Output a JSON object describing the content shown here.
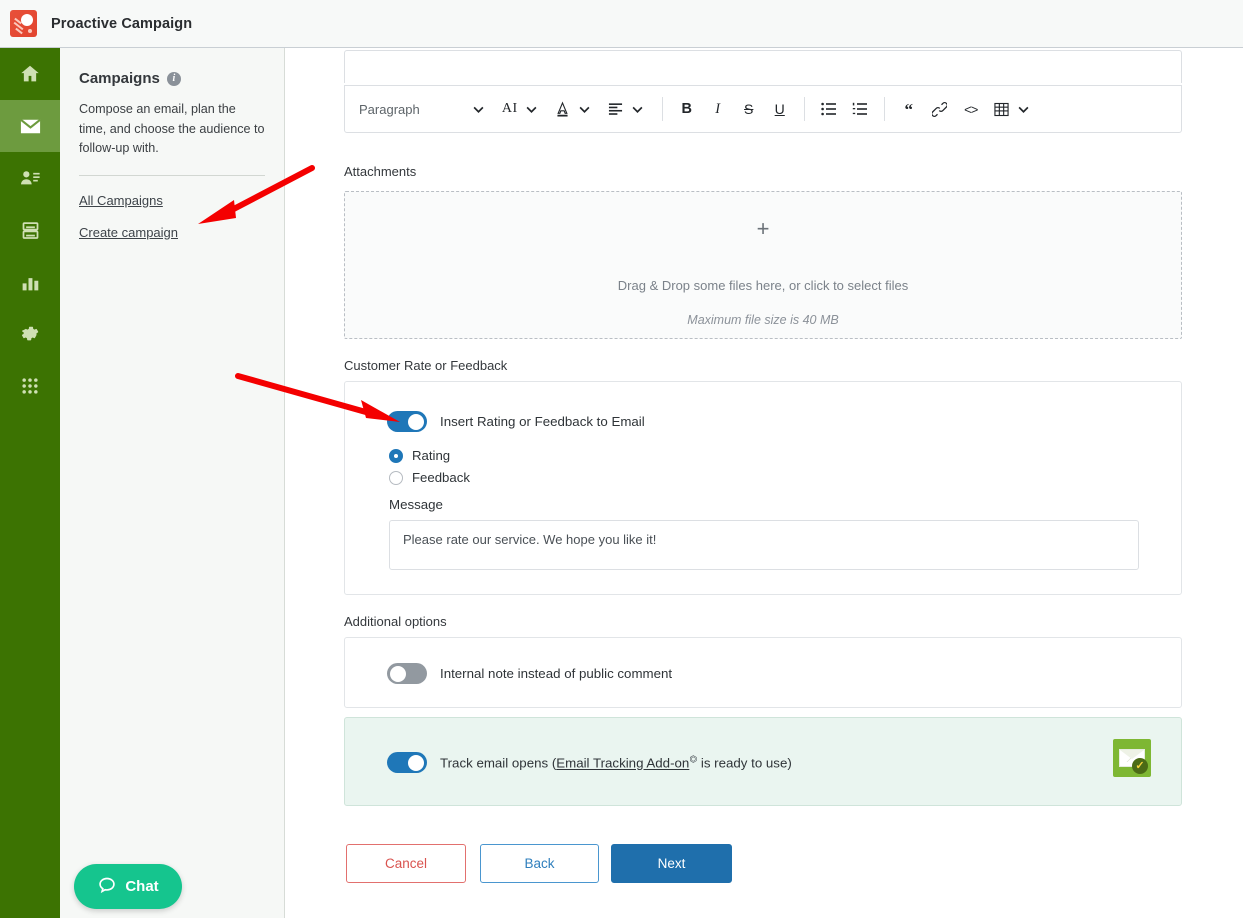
{
  "app": {
    "title": "Proactive Campaign",
    "logo_icon": "comet-logo-icon"
  },
  "rail": {
    "items": [
      {
        "name": "home",
        "icon": "home-icon",
        "active": false
      },
      {
        "name": "mail",
        "icon": "envelope-icon",
        "active": true
      },
      {
        "name": "contacts",
        "icon": "user-list-icon",
        "active": false
      },
      {
        "name": "knowledge-base",
        "icon": "database-icon",
        "active": false
      },
      {
        "name": "reports",
        "icon": "bar-chart-icon",
        "active": false
      },
      {
        "name": "settings",
        "icon": "gear-icon",
        "active": false
      },
      {
        "name": "apps",
        "icon": "grid-dots-icon",
        "active": false
      }
    ]
  },
  "panel": {
    "title": "Campaigns",
    "info_icon": "info-icon",
    "description": "Compose an email, plan the time, and choose the audience to follow-up with.",
    "links": [
      {
        "label": "All Campaigns"
      },
      {
        "label": "Create campaign"
      }
    ]
  },
  "chat": {
    "label": "Chat",
    "icon": "chat-bubble-icon",
    "color": "#15c58e"
  },
  "toolbar": {
    "block_format": "Paragraph",
    "ai_label": "AI",
    "buttons": [
      {
        "name": "block-format-chevron",
        "icon": "chevron-down-icon"
      },
      {
        "name": "ai-tools",
        "icon": "ai-text-icon"
      },
      {
        "name": "ai-chevron",
        "icon": "chevron-down-icon"
      },
      {
        "name": "text-color",
        "icon": "text-color-icon"
      },
      {
        "name": "text-color-chevron",
        "icon": "chevron-down-icon"
      },
      {
        "name": "align",
        "icon": "align-left-icon"
      },
      {
        "name": "align-chevron",
        "icon": "chevron-down-icon"
      },
      {
        "name": "bold",
        "icon": "bold-icon",
        "glyph": "B"
      },
      {
        "name": "italic",
        "icon": "italic-icon",
        "glyph": "I"
      },
      {
        "name": "strikethrough",
        "icon": "strikethrough-icon",
        "glyph": "S"
      },
      {
        "name": "underline",
        "icon": "underline-icon",
        "glyph": "U"
      },
      {
        "name": "bullet-list",
        "icon": "bullet-list-icon"
      },
      {
        "name": "numbered-list",
        "icon": "numbered-list-icon"
      },
      {
        "name": "blockquote",
        "icon": "quote-icon",
        "glyph": "“"
      },
      {
        "name": "link",
        "icon": "link-icon"
      },
      {
        "name": "code",
        "icon": "code-icon",
        "glyph": "<>"
      },
      {
        "name": "table",
        "icon": "table-icon"
      },
      {
        "name": "table-chevron",
        "icon": "chevron-down-icon"
      }
    ]
  },
  "attachments": {
    "label": "Attachments",
    "plus_icon": "plus-icon",
    "drop_text": "Drag & Drop some files here, or click to select files",
    "max_size_text": "Maximum file size is 40 MB"
  },
  "rate_feedback": {
    "label": "Customer Rate or Feedback",
    "toggle_label": "Insert Rating or Feedback to Email",
    "toggle_on": true,
    "options": [
      {
        "label": "Rating",
        "selected": true
      },
      {
        "label": "Feedback",
        "selected": false
      }
    ],
    "message_label": "Message",
    "message_value": "Please rate our service. We hope you like it!"
  },
  "additional_options": {
    "label": "Additional options",
    "internal_note": {
      "label": "Internal note instead of public comment",
      "toggle_on": false
    },
    "track_opens": {
      "label_prefix": "Track email opens (",
      "link_label": "Email Tracking Add-on",
      "external_icon": "external-link-icon",
      "label_suffix": " is ready to use)",
      "toggle_on": true,
      "badge_icon": "email-tracking-badge-icon"
    }
  },
  "footer": {
    "cancel_label": "Cancel",
    "back_label": "Back",
    "next_label": "Next"
  },
  "annotations": {
    "arrows": [
      {
        "name": "arrow-to-create-campaign"
      },
      {
        "name": "arrow-to-insert-rating-toggle"
      }
    ],
    "color": "#f40000"
  }
}
